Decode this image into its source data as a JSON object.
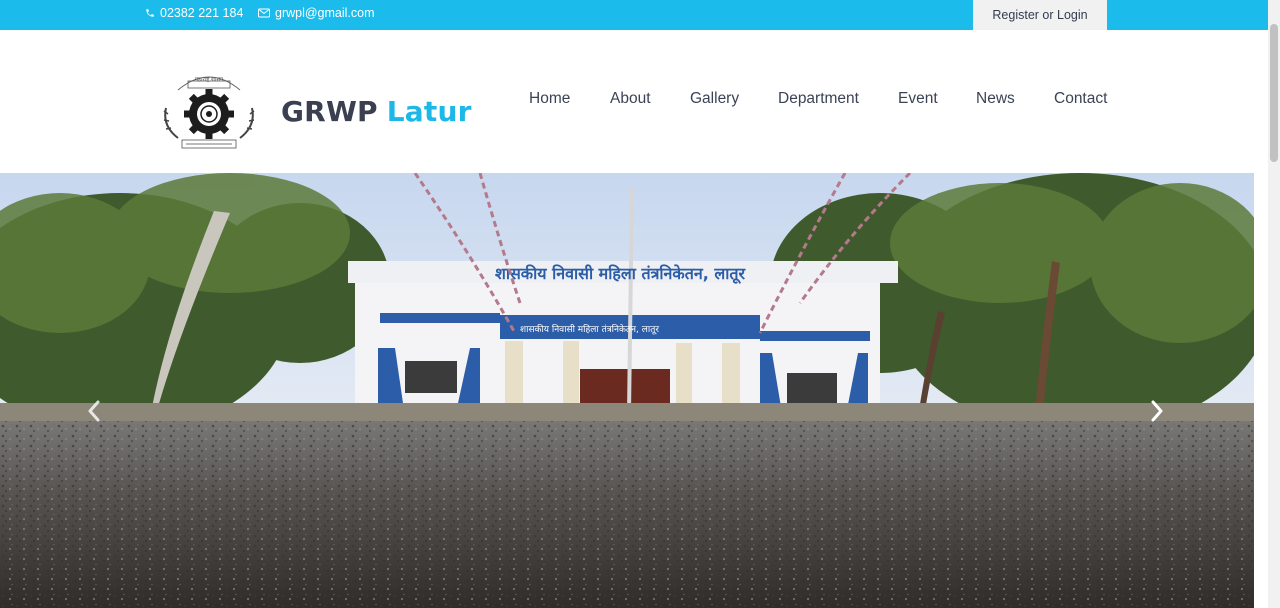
{
  "topbar": {
    "phone": "02382 221 184",
    "phone_icon": "phone-icon",
    "email": "grwpl@gmail.com",
    "email_icon": "envelope-icon",
    "register_label": "Register or Login",
    "color": "#1bbcec"
  },
  "header": {
    "logo_icon": "gear-emblem-logo",
    "brand_main": "GRWP",
    "brand_accent": "Latur",
    "accent_color": "#1bb8e8"
  },
  "nav": [
    {
      "label": "Home"
    },
    {
      "label": "About"
    },
    {
      "label": "Gallery"
    },
    {
      "label": "Department"
    },
    {
      "label": "Event"
    },
    {
      "label": "News"
    },
    {
      "label": "Contact"
    }
  ],
  "hero": {
    "image": "college-building-photo",
    "building_sign": "शासकीय निवासी महिला तंत्रनिकेतन, लातूर",
    "prev_icon": "chevron-left-icon",
    "next_icon": "chevron-right-icon"
  }
}
